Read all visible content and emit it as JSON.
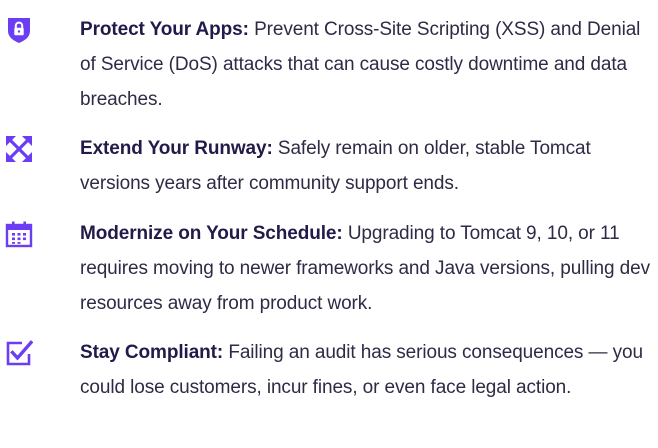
{
  "accent_color": "#6b3ef5",
  "items": [
    {
      "icon": "shield-lock-icon",
      "title": "Protect Your Apps:",
      "body": "Prevent Cross-Site Scripting (XSS) and Denial of Service (DoS) attacks that can cause costly downtime and data breaches."
    },
    {
      "icon": "expand-arrows-icon",
      "title": "Extend Your Runway:",
      "body": "Safely remain on older, stable Tomcat versions years after community support ends."
    },
    {
      "icon": "calendar-icon",
      "title": "Modernize on Your Schedule:",
      "body": "Upgrading to Tomcat 9, 10, or 11 requires moving to newer frameworks and Java versions, pulling dev resources away from product work."
    },
    {
      "icon": "checkbox-check-icon",
      "title": "Stay Compliant:",
      "body": "Failing an audit has serious consequences — you could lose customers, incur fines, or even face legal action."
    }
  ]
}
